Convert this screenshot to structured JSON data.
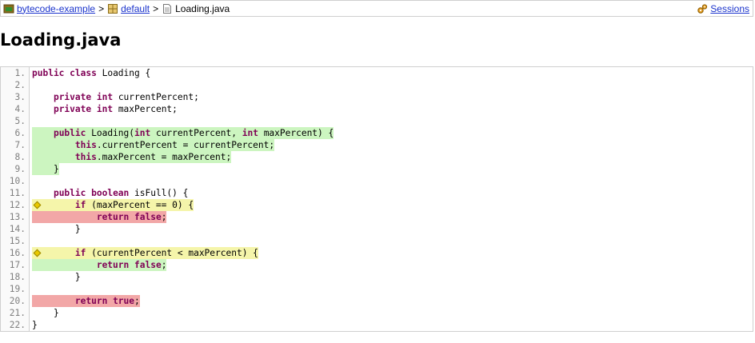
{
  "breadcrumb": {
    "project": "bytecode-example",
    "package": "default",
    "file": "Loading.java",
    "separator": ">",
    "sessions": "Sessions"
  },
  "title": "Loading.java",
  "coverage_colors": {
    "fully_covered": "#ccf5c0",
    "partly_covered": "#f5f5aa",
    "not_covered": "#f2a7a7",
    "keyword": "#7f0055",
    "link": "#1a33cc"
  },
  "lines": [
    {
      "num": "1.",
      "coverage": "none-bg",
      "branch": false,
      "tokens": [
        {
          "t": "public",
          "k": true
        },
        {
          "t": " "
        },
        {
          "t": "class",
          "k": true
        },
        {
          "t": " Loading {"
        }
      ]
    },
    {
      "num": "2.",
      "coverage": "",
      "branch": false,
      "tokens": []
    },
    {
      "num": "3.",
      "coverage": "",
      "branch": false,
      "tokens": [
        {
          "t": "    "
        },
        {
          "t": "private",
          "k": true
        },
        {
          "t": " "
        },
        {
          "t": "int",
          "k": true
        },
        {
          "t": " currentPercent;"
        }
      ]
    },
    {
      "num": "4.",
      "coverage": "",
      "branch": false,
      "tokens": [
        {
          "t": "    "
        },
        {
          "t": "private",
          "k": true
        },
        {
          "t": " "
        },
        {
          "t": "int",
          "k": true
        },
        {
          "t": " maxPercent;"
        }
      ]
    },
    {
      "num": "5.",
      "coverage": "",
      "branch": false,
      "tokens": []
    },
    {
      "num": "6.",
      "coverage": "full",
      "branch": false,
      "tokens": [
        {
          "t": "    "
        },
        {
          "t": "public",
          "k": true
        },
        {
          "t": " Loading("
        },
        {
          "t": "int",
          "k": true
        },
        {
          "t": " currentPercent, "
        },
        {
          "t": "int",
          "k": true
        },
        {
          "t": " maxPercent) {"
        }
      ]
    },
    {
      "num": "7.",
      "coverage": "full",
      "branch": false,
      "tokens": [
        {
          "t": "        "
        },
        {
          "t": "this",
          "k": true
        },
        {
          "t": ".currentPercent = currentPercent;"
        }
      ]
    },
    {
      "num": "8.",
      "coverage": "full",
      "branch": false,
      "tokens": [
        {
          "t": "        "
        },
        {
          "t": "this",
          "k": true
        },
        {
          "t": ".maxPercent = maxPercent;"
        }
      ]
    },
    {
      "num": "9.",
      "coverage": "full",
      "branch": false,
      "tokens": [
        {
          "t": "    }"
        }
      ]
    },
    {
      "num": "10.",
      "coverage": "",
      "branch": false,
      "tokens": []
    },
    {
      "num": "11.",
      "coverage": "",
      "branch": false,
      "tokens": [
        {
          "t": "    "
        },
        {
          "t": "public",
          "k": true
        },
        {
          "t": " "
        },
        {
          "t": "boolean",
          "k": true
        },
        {
          "t": " isFull() {"
        }
      ]
    },
    {
      "num": "12.",
      "coverage": "partial",
      "branch": true,
      "tokens": [
        {
          "t": "        "
        },
        {
          "t": "if",
          "k": true
        },
        {
          "t": " (maxPercent == 0) {"
        }
      ]
    },
    {
      "num": "13.",
      "coverage": "none",
      "branch": false,
      "tokens": [
        {
          "t": "            "
        },
        {
          "t": "return",
          "k": true
        },
        {
          "t": " "
        },
        {
          "t": "false",
          "k": true
        },
        {
          "t": ";"
        }
      ]
    },
    {
      "num": "14.",
      "coverage": "",
      "branch": false,
      "tokens": [
        {
          "t": "        }"
        }
      ]
    },
    {
      "num": "15.",
      "coverage": "",
      "branch": false,
      "tokens": []
    },
    {
      "num": "16.",
      "coverage": "partial",
      "branch": true,
      "tokens": [
        {
          "t": "        "
        },
        {
          "t": "if",
          "k": true
        },
        {
          "t": " (currentPercent < maxPercent) {"
        }
      ]
    },
    {
      "num": "17.",
      "coverage": "full",
      "branch": false,
      "tokens": [
        {
          "t": "            "
        },
        {
          "t": "return",
          "k": true
        },
        {
          "t": " "
        },
        {
          "t": "false",
          "k": true
        },
        {
          "t": ";"
        }
      ]
    },
    {
      "num": "18.",
      "coverage": "",
      "branch": false,
      "tokens": [
        {
          "t": "        }"
        }
      ]
    },
    {
      "num": "19.",
      "coverage": "",
      "branch": false,
      "tokens": []
    },
    {
      "num": "20.",
      "coverage": "none",
      "branch": false,
      "tokens": [
        {
          "t": "        "
        },
        {
          "t": "return",
          "k": true
        },
        {
          "t": " "
        },
        {
          "t": "true",
          "k": true
        },
        {
          "t": ";"
        }
      ]
    },
    {
      "num": "21.",
      "coverage": "",
      "branch": false,
      "tokens": [
        {
          "t": "    }"
        }
      ]
    },
    {
      "num": "22.",
      "coverage": "",
      "branch": false,
      "tokens": [
        {
          "t": "}"
        }
      ]
    }
  ]
}
